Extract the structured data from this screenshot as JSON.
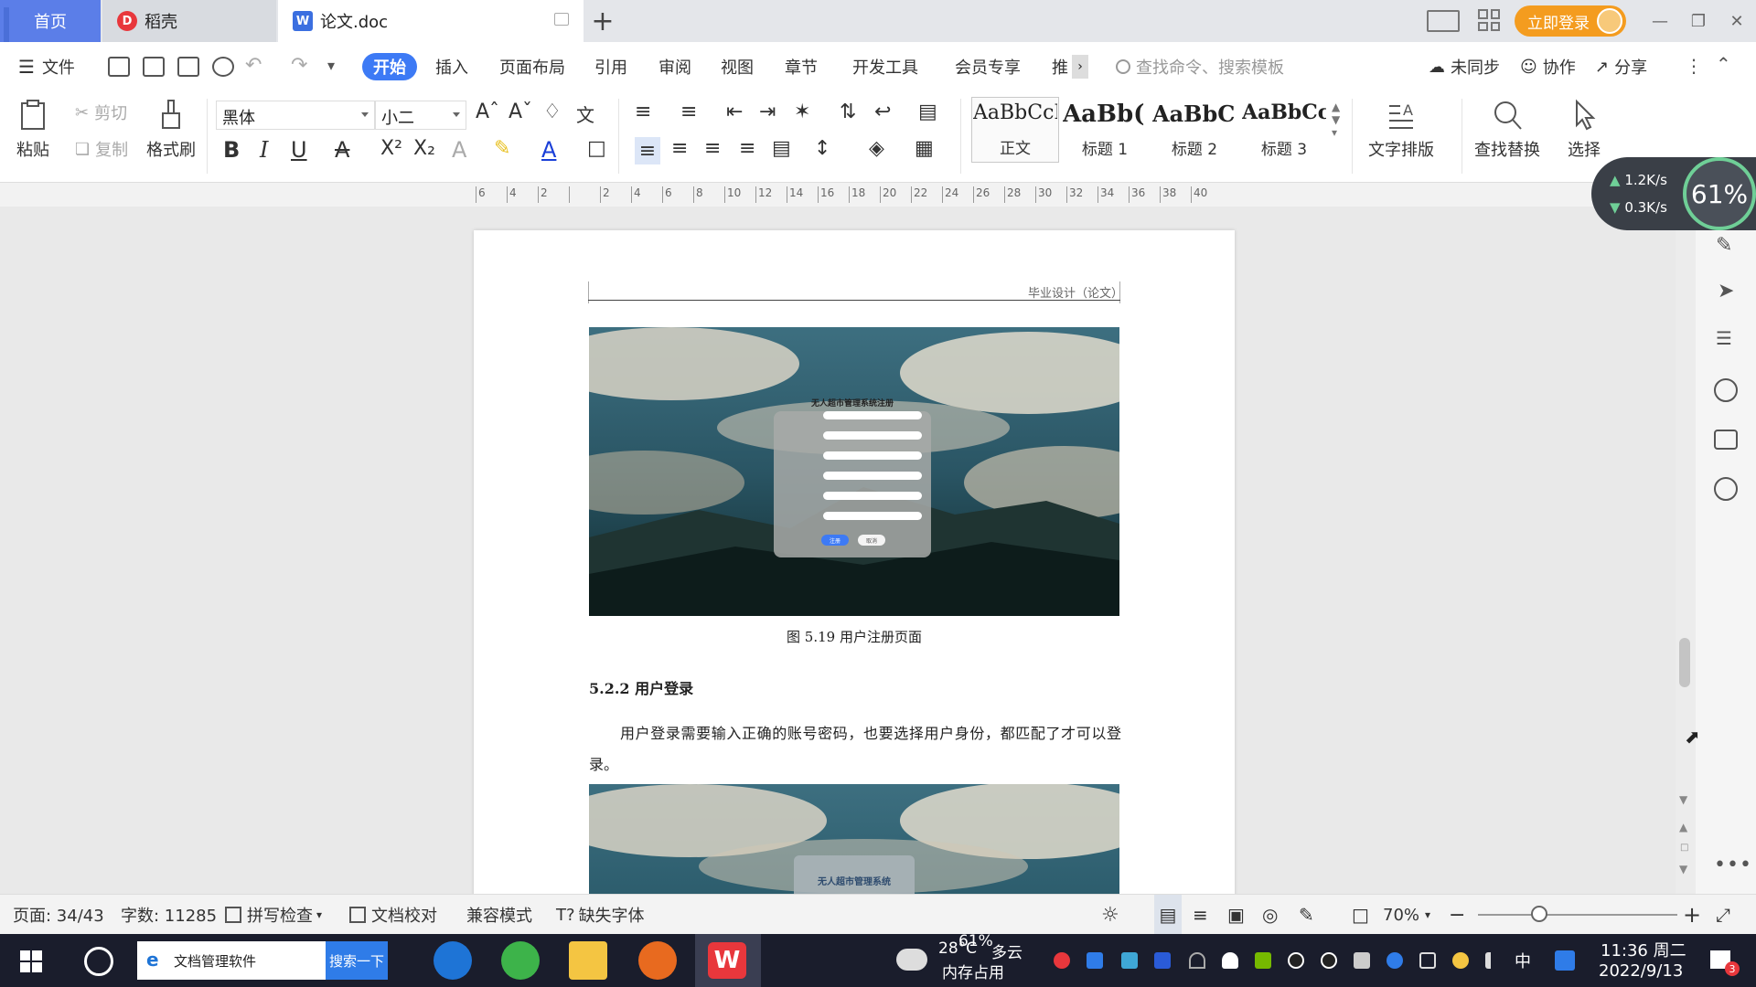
{
  "titlebar": {
    "tabs": [
      {
        "label": "首页"
      },
      {
        "label": "稻壳"
      },
      {
        "label": "论文.doc"
      }
    ],
    "login_label": "立即登录"
  },
  "menubar": {
    "file_label": "文件",
    "items": [
      "开始",
      "插入",
      "页面布局",
      "引用",
      "审阅",
      "视图",
      "章节",
      "开发工具",
      "会员专享",
      "推"
    ],
    "search_placeholder": "查找命令、搜索模板",
    "sync_label": "未同步",
    "collab_label": "协作",
    "share_label": "分享"
  },
  "ribbon": {
    "paste_label": "粘贴",
    "cut_label": "剪切",
    "copy_label": "复制",
    "format_painter_label": "格式刷",
    "font_name": "黑体",
    "font_size": "小二",
    "styles": [
      {
        "sample": "AaBbCcI",
        "name": "正文"
      },
      {
        "sample": "AaBb(",
        "name": "标题 1"
      },
      {
        "sample": "AaBbC",
        "name": "标题 2"
      },
      {
        "sample": "AaBbCcl",
        "name": "标题 3"
      }
    ],
    "text_layout_label": "文字排版",
    "find_replace_label": "查找替换",
    "select_label": "选择"
  },
  "ruler": {
    "ticks": [
      "6",
      "4",
      "2",
      "",
      "2",
      "4",
      "6",
      "8",
      "10",
      "12",
      "14",
      "16",
      "18",
      "20",
      "22",
      "24",
      "26",
      "28",
      "30",
      "32",
      "34",
      "36",
      "38",
      "40"
    ]
  },
  "document": {
    "header_text": "毕业设计（论文）",
    "figure1": {
      "form_title": "无人超市管理系统注册",
      "btn_primary": "注册",
      "btn_secondary": "取消"
    },
    "caption": "图 5.19  用户注册页面",
    "section_title": "5.2.2  用户登录",
    "paragraph": "用户登录需要输入正确的账号密码，也要选择用户身份，都匹配了才可以登录。",
    "figure2": {
      "form_title": "无人超市管理系统"
    }
  },
  "speed_widget": {
    "up": "1.2K/s",
    "down": "0.3K/s",
    "percent": "61%"
  },
  "statusbar": {
    "page": "页面: 34/43",
    "word_count": "字数: 11285",
    "spell_check": "拼写检查",
    "proofread": "文档校对",
    "compat_mode": "兼容模式",
    "missing_font": "缺失字体",
    "zoom": "70%"
  },
  "taskbar": {
    "search_text": "文档管理软件",
    "search_button": "搜索一下",
    "weather_temp": "28°C",
    "weather_desc": "多云",
    "memory_pct": "61%",
    "memory_label": "内存占用",
    "ime": "中",
    "time": "11:36 周二",
    "date": "2022/9/13",
    "notif_count": "3"
  }
}
